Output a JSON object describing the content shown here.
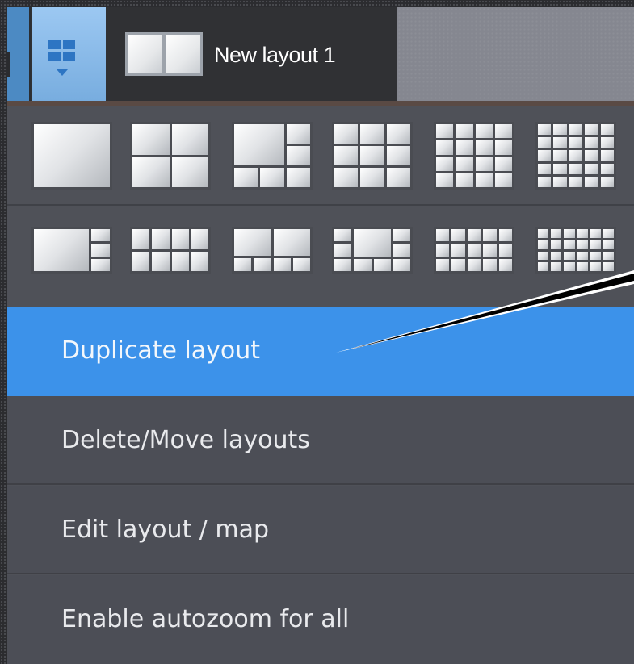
{
  "tab": {
    "label": "New layout 1"
  },
  "layout_grid": {
    "row1": [
      "1x1",
      "2x2",
      "1+5",
      "3x3",
      "4x4",
      "5x5"
    ],
    "row2": [
      "1+3",
      "2x4",
      "2+6",
      "2+8",
      "3x5",
      "4x6"
    ]
  },
  "menu": {
    "duplicate": "Duplicate layout",
    "delete_move": "Delete/Move layouts",
    "edit": "Edit layout / map",
    "autozoom": "Enable autozoom for all"
  },
  "colors": {
    "selected_menu": "#3c92ea",
    "menu_bg": "#4c4e56",
    "layout_button": "#78addf"
  }
}
